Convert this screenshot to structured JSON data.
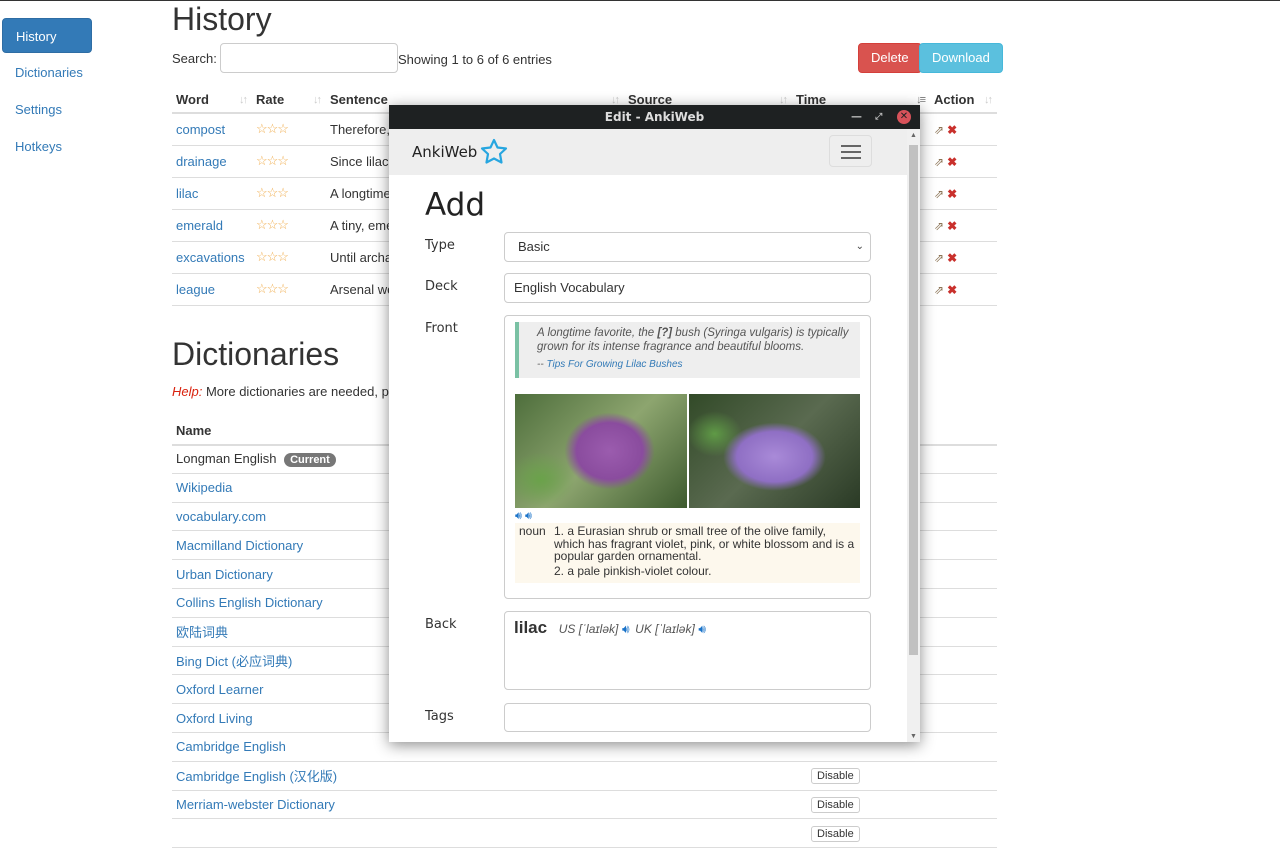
{
  "sidebar": {
    "items": [
      {
        "label": "History",
        "active": true
      },
      {
        "label": "Dictionaries"
      },
      {
        "label": "Settings"
      },
      {
        "label": "Hotkeys"
      }
    ]
  },
  "history": {
    "title": "History",
    "search_label": "Search:",
    "search_value": "",
    "info": "Showing 1 to 6 of 6 entries",
    "delete_label": "Delete",
    "download_label": "Download",
    "columns": [
      "Word",
      "Rate",
      "Sentence",
      "Source",
      "Time",
      "Action"
    ],
    "rows": [
      {
        "word": "compost",
        "rate": "☆☆☆",
        "sentence": "Therefore,"
      },
      {
        "word": "drainage",
        "rate": "☆☆☆",
        "sentence": "Since lilacs"
      },
      {
        "word": "lilac",
        "rate": "☆☆☆",
        "sentence": "A longtime"
      },
      {
        "word": "emerald",
        "rate": "☆☆☆",
        "sentence": "A tiny, eme"
      },
      {
        "word": "excavations",
        "rate": "☆☆☆",
        "sentence": "Until archa"
      },
      {
        "word": "league",
        "rate": "☆☆☆",
        "sentence": "Arsenal we"
      }
    ]
  },
  "dictionaries": {
    "title": "Dictionaries",
    "help_label": "Help:",
    "help_text": " More dictionaries are needed, plea",
    "column": "Name",
    "current_badge": "Current",
    "disable_label": "Disable",
    "items": [
      {
        "name": "Longman English",
        "current": true
      },
      {
        "name": "Wikipedia"
      },
      {
        "name": "vocabulary.com"
      },
      {
        "name": "Macmilland Dictionary"
      },
      {
        "name": "Urban Dictionary"
      },
      {
        "name": "Collins English Dictionary"
      },
      {
        "name": "欧陆词典"
      },
      {
        "name": "Bing Dict (必应词典)"
      },
      {
        "name": "Oxford Learner"
      },
      {
        "name": "Oxford Living"
      },
      {
        "name": "Cambridge English"
      },
      {
        "name": "Cambridge English (汉化版)",
        "show_disable": true
      },
      {
        "name": "Merriam-webster Dictionary",
        "show_disable": true
      }
    ]
  },
  "modal": {
    "window_title": "Edit - AnkiWeb",
    "brand": "AnkiWeb",
    "brand_color": "#27a6e0",
    "heading": "Add",
    "type_label": "Type",
    "type_value": "Basic",
    "deck_label": "Deck",
    "deck_value": "English Vocabulary",
    "front_label": "Front",
    "front": {
      "quote_before": "A longtime favorite, the ",
      "quote_blank": "[?]",
      "quote_after": " bush (Syringa vulgaris) is typically grown for its intense fragrance and beautiful blooms.",
      "source_prefix": "-- ",
      "source_link": "Tips For Growing Lilac Bushes",
      "pos": "noun",
      "senses": [
        "1. a Eurasian shrub or small tree of the olive family, which has fragrant violet, pink, or white blossom and is a popular garden ornamental.",
        "2. a pale pinkish-violet colour."
      ]
    },
    "back_label": "Back",
    "back": {
      "word": "lilac",
      "us": "US [ˈlaɪlək]",
      "uk": "UK [ˈlaɪlək]"
    },
    "tags_label": "Tags",
    "tags_value": ""
  }
}
